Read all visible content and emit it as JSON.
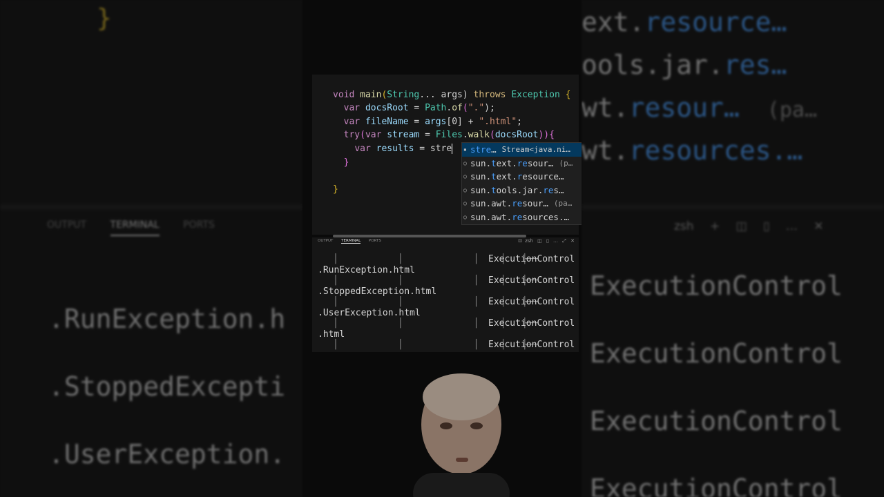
{
  "editor": {
    "line1": {
      "void": "void ",
      "main": "main",
      "paren_open": "(",
      "string": "String",
      "args_decl": "... args) ",
      "throws": "throws ",
      "exception": "Exception",
      "brace": " {"
    },
    "line2": {
      "var": "var ",
      "name": "docsRoot",
      "eq": " = ",
      "type": "Path",
      "dot": ".",
      "fn": "of",
      "open": "(",
      "str": "\".\"",
      "close": ");"
    },
    "line3": {
      "var": "var ",
      "name": "fileName",
      "eq": " = ",
      "args": "args",
      "idx": "[0]",
      "plus": " + ",
      "str": "\".html\"",
      "end": ";"
    },
    "line4": {
      "try": "try",
      "open": "(",
      "var": "var ",
      "name": "stream",
      "eq": " = ",
      "type": "Files",
      "dot": ".",
      "fn": "walk",
      "open2": "(",
      "arg": "docsRoot",
      "close": "))",
      "brace": "{"
    },
    "line5": {
      "var": "var ",
      "name": "results",
      "eq": " = ",
      "typed": "stre"
    },
    "line6": "}",
    "line7": "}"
  },
  "suggestions": [
    {
      "hl": "stre",
      "rest": "…",
      "detail": "Stream<java.ni…",
      "icon": "▪"
    },
    {
      "pre": "sun.",
      "hl": "t",
      "mid": "ext.",
      "hl2": "re",
      "rest": "sour…",
      "detail": "(p…",
      "icon": "○"
    },
    {
      "pre": "sun.",
      "hl": "t",
      "mid": "ext.",
      "hl2": "r",
      "rest": "esource…",
      "detail": "",
      "icon": "○"
    },
    {
      "pre": "sun.",
      "hl": "t",
      "mid": "ools.jar.",
      "hl2": "re",
      "rest": "s…",
      "detail": "",
      "icon": "○"
    },
    {
      "pre": "sun.awt.",
      "hl": "re",
      "mid": "sour…",
      "hl2": "",
      "rest": "",
      "detail": "(pa…",
      "icon": "○"
    },
    {
      "pre": "sun.awt.",
      "hl": "re",
      "mid": "sources.…",
      "hl2": "",
      "rest": "",
      "detail": "",
      "icon": "○"
    }
  ],
  "panel": {
    "tabs": [
      "OUTPUT",
      "TERMINAL",
      "PORTS"
    ],
    "active_tab": "TERMINAL",
    "shell": "zsh"
  },
  "terminal": {
    "files": [
      ".RunException.html",
      ".StoppedException.html",
      ".UserException.html",
      ".html"
    ],
    "control": "ExecutionControl"
  },
  "background": {
    "left_terminal": [
      ".RunException.h",
      ".StoppedExcepti",
      ".UserException."
    ],
    "right_code": [
      "ext.",
      "resource…",
      "ools.jar.",
      "res…",
      "wt.",
      "resour…",
      "(pa…",
      "wt.",
      "resources.…"
    ],
    "right_terminal": "ExecutionControl",
    "brace": "}"
  }
}
